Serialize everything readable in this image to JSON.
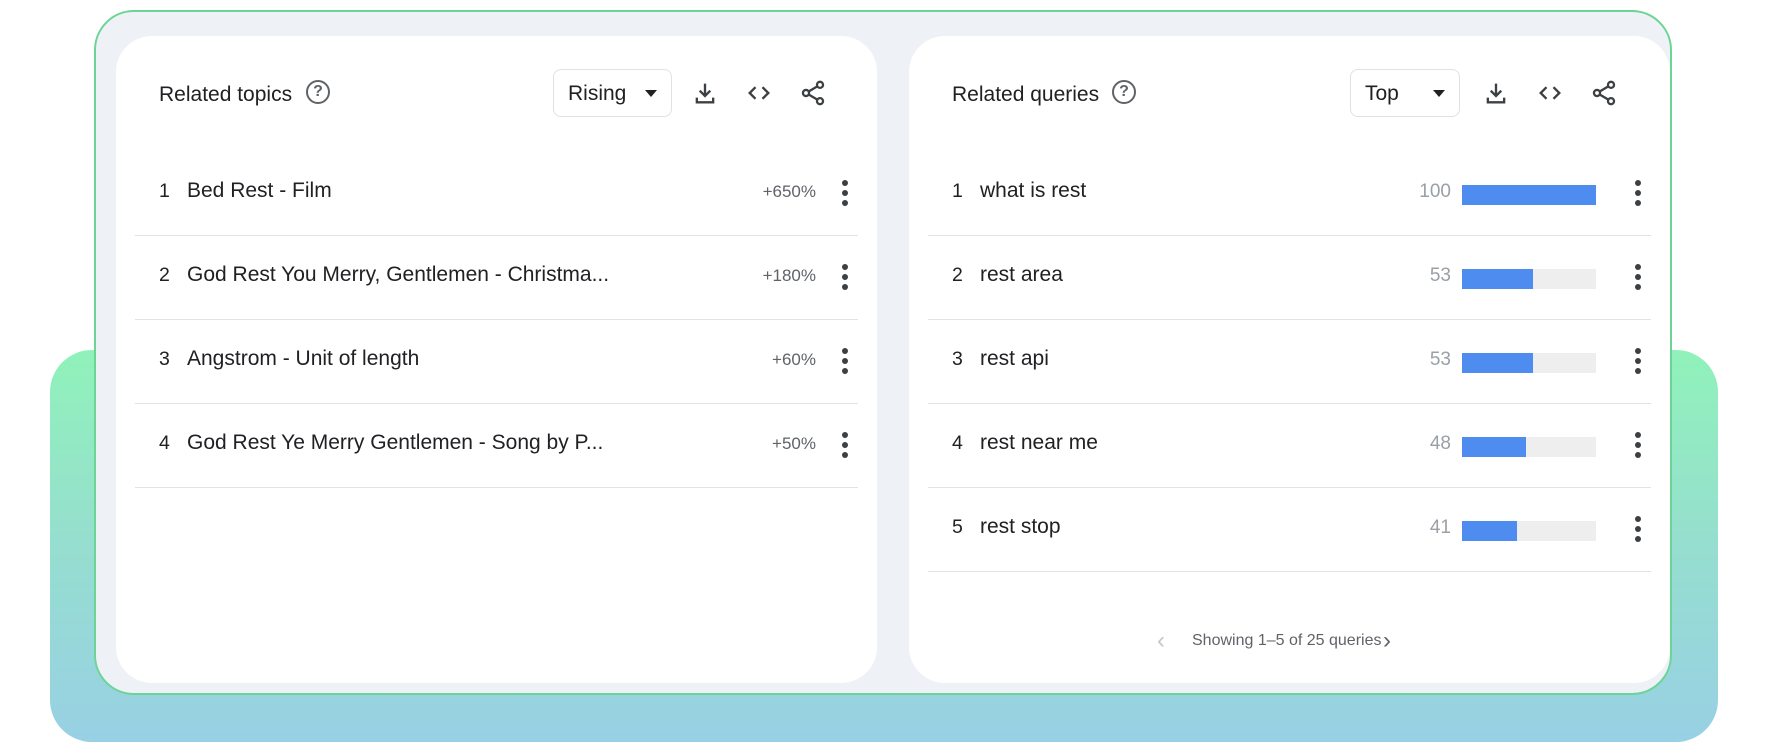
{
  "related_topics": {
    "title": "Related topics",
    "help_icon": "help-circle-icon",
    "filter": {
      "selected": "Rising",
      "icon": "caret-down-icon"
    },
    "toolbar": {
      "download_icon": "download-icon",
      "embed_icon": "code-embed-icon",
      "share_icon": "share-icon"
    },
    "rows": [
      {
        "rank": "1",
        "label": "Bed Rest - Film",
        "value": "+650%"
      },
      {
        "rank": "2",
        "label": "God Rest You Merry, Gentlemen - Christma...",
        "value": "+180%"
      },
      {
        "rank": "3",
        "label": "Angstrom - Unit of length",
        "value": "+60%"
      },
      {
        "rank": "4",
        "label": "God Rest Ye Merry Gentlemen - Song by P...",
        "value": "+50%"
      }
    ]
  },
  "related_queries": {
    "title": "Related queries",
    "help_icon": "help-circle-icon",
    "filter": {
      "selected": "Top",
      "icon": "caret-down-icon"
    },
    "toolbar": {
      "download_icon": "download-icon",
      "embed_icon": "code-embed-icon",
      "share_icon": "share-icon"
    },
    "rows": [
      {
        "rank": "1",
        "label": "what is rest",
        "score": 100
      },
      {
        "rank": "2",
        "label": "rest area",
        "score": 53
      },
      {
        "rank": "3",
        "label": "rest api",
        "score": 53
      },
      {
        "rank": "4",
        "label": "rest near me",
        "score": 48
      },
      {
        "rank": "5",
        "label": "rest stop",
        "score": 41
      }
    ],
    "pagination": {
      "text": "Showing 1–5 of 25 queries",
      "prev_icon": "chevron-left-icon",
      "next_icon": "chevron-right-icon",
      "prev_enabled": false,
      "next_enabled": true
    }
  },
  "colors": {
    "bar_fill": "#4E8CF0",
    "bar_track": "#EEEEEE",
    "frame_border": "#6CD494",
    "frame_bg": "#EEF2F7",
    "backdrop_top": "#90F2BA",
    "backdrop_bottom": "#98D0E4"
  }
}
